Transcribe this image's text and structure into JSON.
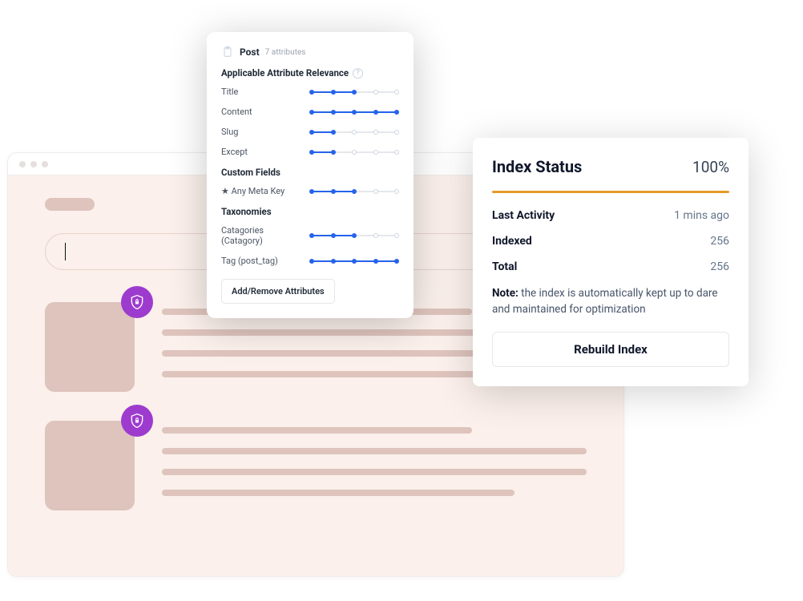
{
  "attr_panel": {
    "post_label": "Post",
    "attr_count": "7 attributes",
    "section_title": "Applicable Attribute Relevance",
    "rows": [
      {
        "label": "Title",
        "value": 2,
        "max": 4
      },
      {
        "label": "Content",
        "value": 4,
        "max": 4
      },
      {
        "label": "Slug",
        "value": 1,
        "max": 4
      },
      {
        "label": "Except",
        "value": 1,
        "max": 4
      }
    ],
    "custom_fields_title": "Custom Fields",
    "custom_fields": [
      {
        "label": "★ Any Meta Key",
        "value": 2,
        "max": 4
      }
    ],
    "taxonomies_title": "Taxonomies",
    "taxonomies": [
      {
        "label": "Catagories (Catagory)",
        "value": 2,
        "max": 4
      },
      {
        "label": "Tag (post_tag)",
        "value": 4,
        "max": 4
      }
    ],
    "add_remove_label": "Add/Remove Attributes"
  },
  "status_panel": {
    "title": "Index Status",
    "percent": "100%",
    "rows": [
      {
        "key": "Last Activity",
        "val": "1 mins ago"
      },
      {
        "key": "Indexed",
        "val": "256"
      },
      {
        "key": "Total",
        "val": "256"
      }
    ],
    "note_label": "Note:",
    "note_text": " the index is automatically kept up to dare and maintained for optimization",
    "rebuild_label": "Rebuild Index"
  }
}
